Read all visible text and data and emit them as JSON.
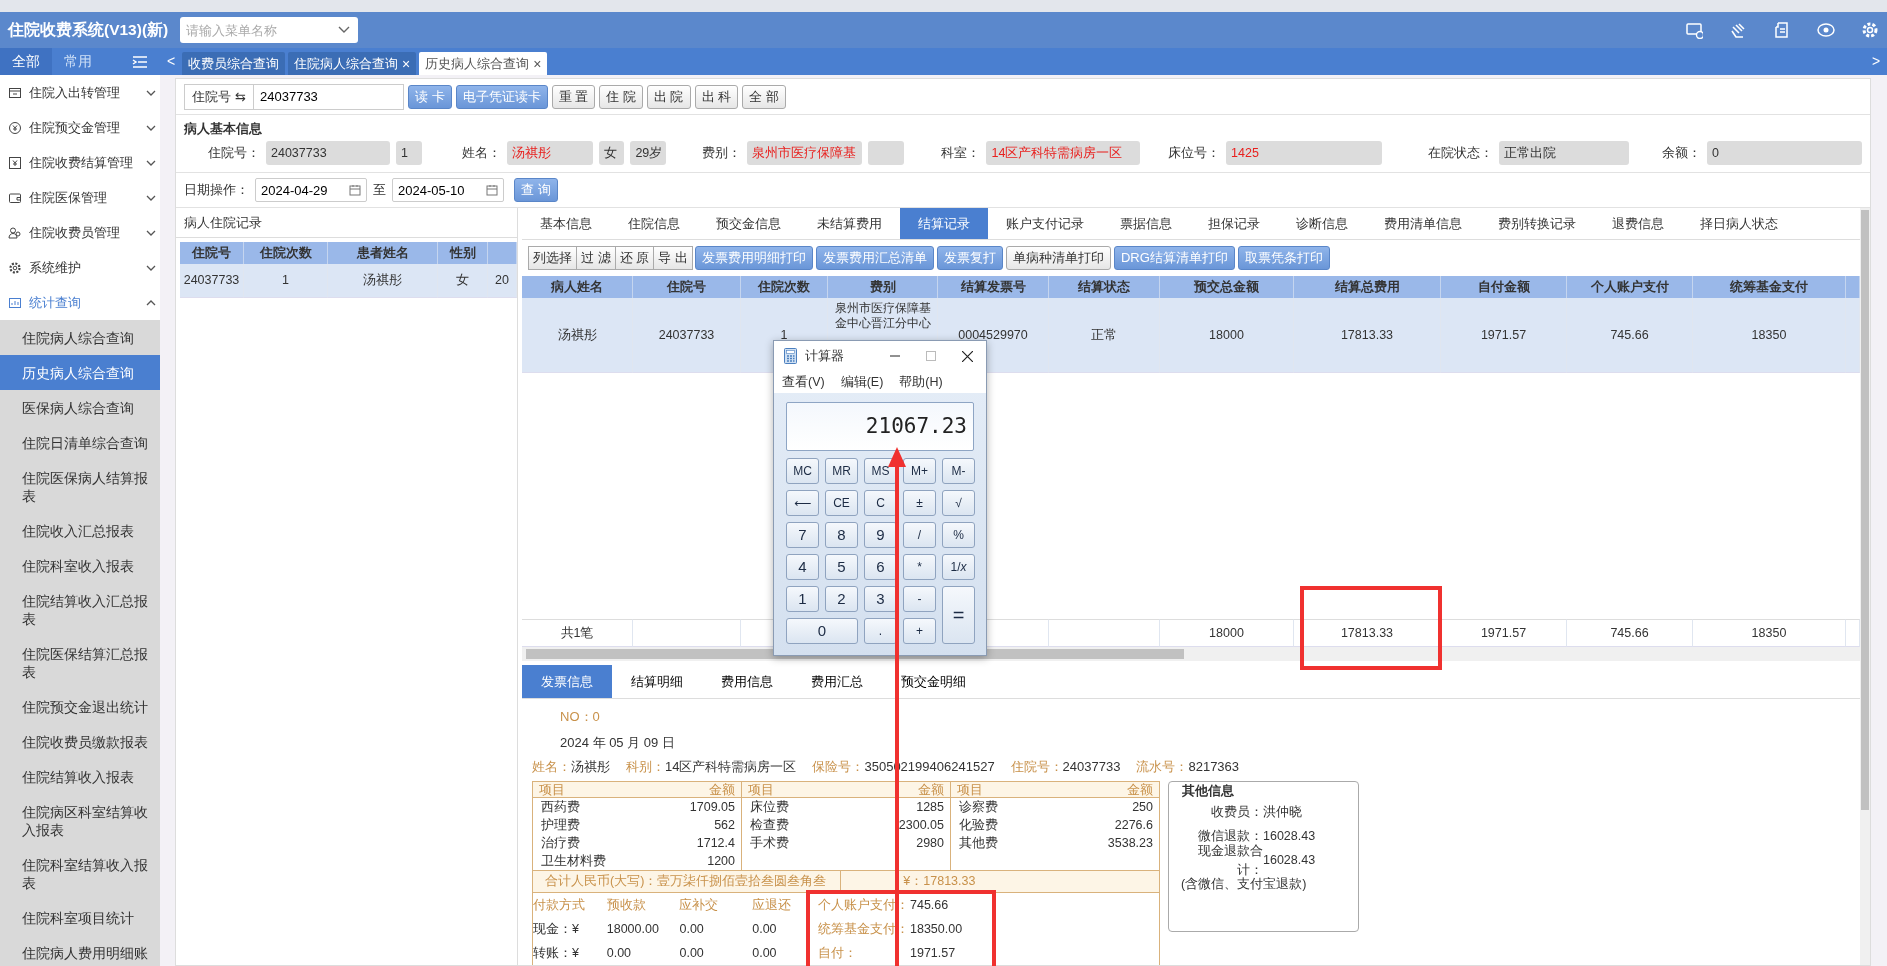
{
  "header": {
    "title": "住院收费系统(V13)(新)",
    "menu_search": {
      "placeholder": "请输入菜单名称"
    }
  },
  "sidebar": {
    "tabs": [
      {
        "label": "全部",
        "selected": true
      },
      {
        "label": "常用",
        "selected": false
      }
    ],
    "groups": [
      {
        "label": "住院入出转管理",
        "expanded": false
      },
      {
        "label": "住院预交金管理",
        "expanded": false
      },
      {
        "label": "住院收费结算管理",
        "expanded": false
      },
      {
        "label": "住院医保管理",
        "expanded": false
      },
      {
        "label": "住院收费员管理",
        "expanded": false
      },
      {
        "label": "系统维护",
        "expanded": false
      },
      {
        "label": "统计查询",
        "expanded": true,
        "children": [
          {
            "label": "住院病人综合查询",
            "selected": false
          },
          {
            "label": "历史病人综合查询",
            "selected": true
          },
          {
            "label": "医保病人综合查询",
            "selected": false
          },
          {
            "label": "住院日清单综合查询",
            "selected": false
          },
          {
            "label": "住院医保病人结算报表",
            "selected": false
          },
          {
            "label": "住院收入汇总报表",
            "selected": false
          },
          {
            "label": "住院科室收入报表",
            "selected": false
          },
          {
            "label": "住院结算收入汇总报表",
            "selected": false
          },
          {
            "label": "住院医保结算汇总报表",
            "selected": false
          },
          {
            "label": "住院预交金退出统计",
            "selected": false
          },
          {
            "label": "住院收费员缴款报表",
            "selected": false
          },
          {
            "label": "住院结算收入报表",
            "selected": false
          },
          {
            "label": "住院病区科室结算收入报表",
            "selected": false
          },
          {
            "label": "住院科室结算收入报表",
            "selected": false
          },
          {
            "label": "住院科室项目统计",
            "selected": false
          },
          {
            "label": "住院病人费用明细账",
            "selected": false
          }
        ]
      }
    ]
  },
  "page_tabs": {
    "scroll_left": "<",
    "scroll_right": ">",
    "items": [
      {
        "label": "收费员综合查询",
        "selected": false
      },
      {
        "label": "住院病人综合查询",
        "selected": false,
        "close": "×"
      },
      {
        "label": "历史病人综合查询",
        "selected": true,
        "close": "×"
      }
    ]
  },
  "search_bar": {
    "key_label": "住院号",
    "swap_glyph": "⇆",
    "value": "24037733",
    "buttons": [
      {
        "label": "读 卡",
        "kind": "primary"
      },
      {
        "label": "电子凭证读卡",
        "kind": "primary"
      },
      {
        "label": "重 置",
        "kind": "default"
      },
      {
        "label": "住 院",
        "kind": "default"
      },
      {
        "label": "出 院",
        "kind": "default"
      },
      {
        "label": "出 科",
        "kind": "default"
      },
      {
        "label": "全 部",
        "kind": "default"
      }
    ]
  },
  "patient_info": {
    "title": "病人基本信息",
    "fields": [
      {
        "label": "住院号：",
        "values": [
          {
            "kind": "text",
            "text": "24037733",
            "highlighted": false
          },
          {
            "kind": "text",
            "text": "1",
            "highlighted": false
          }
        ]
      },
      {
        "label": "姓名：",
        "values": [
          {
            "kind": "text",
            "text": "汤祺彤",
            "highlighted": true
          },
          {
            "kind": "text",
            "text": "女",
            "highlighted": false
          },
          {
            "kind": "text",
            "text": "29岁",
            "highlighted": false
          }
        ]
      },
      {
        "label": "费别：",
        "values": [
          {
            "kind": "text",
            "text": "泉州市医疗保障基",
            "highlighted": true
          },
          {
            "kind": "blank"
          }
        ]
      },
      {
        "label": "科室：",
        "values": [
          {
            "kind": "text",
            "text": "14区产科特需病房一区",
            "highlighted": true
          }
        ]
      },
      {
        "label": "床位号：",
        "values": [
          {
            "kind": "text",
            "text": "1425",
            "highlighted": true
          }
        ]
      },
      {
        "label": "在院状态：",
        "values": [
          {
            "kind": "text",
            "text": "正常出院",
            "highlighted": false
          }
        ]
      },
      {
        "label": "余额：",
        "values": [
          {
            "kind": "text",
            "text": "0",
            "highlighted": false
          }
        ]
      }
    ]
  },
  "date_filter": {
    "label": "日期操作：",
    "from": "2024-04-29",
    "to_label": "至",
    "to": "2024-05-10",
    "button": "查 询"
  },
  "records_panel": {
    "title": "病人住院记录",
    "columns": [
      "住院号",
      "住院次数",
      "患者姓名",
      "性别"
    ],
    "rows": [
      {
        "selected": true,
        "cells": [
          "24037733",
          "1",
          "汤祺彤",
          "女",
          "20"
        ]
      }
    ]
  },
  "detail_tabs": [
    {
      "label": "基本信息",
      "selected": false
    },
    {
      "label": "住院信息",
      "selected": false
    },
    {
      "label": "预交金信息",
      "selected": false
    },
    {
      "label": "未结算费用",
      "selected": false
    },
    {
      "label": "结算记录",
      "selected": true
    },
    {
      "label": "账户支付记录",
      "selected": false
    },
    {
      "label": "票据信息",
      "selected": false
    },
    {
      "label": "担保记录",
      "selected": false
    },
    {
      "label": "诊断信息",
      "selected": false
    },
    {
      "label": "费用清单信息",
      "selected": false
    },
    {
      "label": "费别转换记录",
      "selected": false
    },
    {
      "label": "退费信息",
      "selected": false
    },
    {
      "label": "择日病人状态",
      "selected": false
    }
  ],
  "table_toolbar": [
    {
      "label": "列选择",
      "kind": "plain"
    },
    {
      "label": "过 滤",
      "kind": "plain"
    },
    {
      "label": "还 原",
      "kind": "plain"
    },
    {
      "label": "导 出",
      "kind": "plain"
    },
    {
      "label": "发票费用明细打印",
      "kind": "primary"
    },
    {
      "label": "发票费用汇总清单",
      "kind": "primary"
    },
    {
      "label": "发票复打",
      "kind": "primary"
    },
    {
      "label": "单病种清单打印",
      "kind": "default"
    },
    {
      "label": "DRG结算清单打印",
      "kind": "primary"
    },
    {
      "label": "取票凭条打印",
      "kind": "primary"
    }
  ],
  "settlement_table": {
    "columns": [
      "病人姓名",
      "住院号",
      "住院次数",
      "费别",
      "结算发票号",
      "结算状态",
      "预交总金额",
      "结算总费用",
      "自付金额",
      "个人账户支付",
      "统筹基金支付"
    ],
    "rows": [
      {
        "selected": true,
        "cells": [
          "汤祺彤",
          "24037733",
          "1",
          "泉州市医疗保障基金中心晋江分中心",
          "0004529970",
          "正常",
          "18000",
          "17813.33",
          "1971.57",
          "745.66",
          "18350"
        ]
      }
    ],
    "footer": {
      "label": "共1笔",
      "totals": [
        "18000",
        "17813.33",
        "1971.57",
        "745.66",
        "18350"
      ]
    }
  },
  "invoice_tabs": [
    {
      "label": "发票信息",
      "selected": true
    },
    {
      "label": "结算明细",
      "selected": false
    },
    {
      "label": "费用信息",
      "selected": false
    },
    {
      "label": "费用汇总",
      "selected": false
    },
    {
      "label": "预交金明细",
      "selected": false
    }
  ],
  "invoice": {
    "number": "NO：0",
    "date": "2024 年 05 月 09 日",
    "info": [
      {
        "label": "姓名：",
        "value": "汤祺彤"
      },
      {
        "label": "科别：",
        "value": "14区产科特需病房一区"
      },
      {
        "label": "保险号：",
        "value": "350502199406241527"
      },
      {
        "label": "住院号：",
        "value": "24037733"
      },
      {
        "label": "流水号：",
        "value": "8217363"
      }
    ],
    "fee_groups": [
      {
        "item_header": "项目",
        "amount_header": "金额",
        "items": [
          {
            "name": "西药费",
            "amount": "1709.05"
          },
          {
            "name": "护理费",
            "amount": "562"
          },
          {
            "name": "治疗费",
            "amount": "1712.4"
          },
          {
            "name": "卫生材料费",
            "amount": "1200"
          }
        ]
      },
      {
        "item_header": "项目",
        "amount_header": "金额",
        "items": [
          {
            "name": "床位费",
            "amount": "1285"
          },
          {
            "name": "检查费",
            "amount": "2300.05"
          },
          {
            "name": "手术费",
            "amount": "2980"
          }
        ]
      },
      {
        "item_header": "项目",
        "amount_header": "金额",
        "items": [
          {
            "name": "诊察费",
            "amount": "250"
          },
          {
            "name": "化验费",
            "amount": "2276.6"
          },
          {
            "name": "其他费",
            "amount": "3538.23"
          }
        ]
      }
    ],
    "total": {
      "label": "合计人民币(大写)：",
      "value": "壹万柒仟捌佰壹拾叁圆叁角叁",
      "amount": "¥：17813.33"
    },
    "payment": {
      "columns": [
        "付款方式",
        "预收款",
        "应补交",
        "应退还"
      ],
      "rows": [
        [
          "现金：¥",
          "18000.00",
          "0.00",
          "0.00"
        ],
        [
          "转账：¥",
          "0.00",
          "0.00",
          "0.00"
        ]
      ]
    },
    "funds": [
      {
        "label": "个人账户支付：",
        "value": "745.66"
      },
      {
        "label": "统筹基金支付：",
        "value": "18350.00"
      },
      {
        "label": "自付：",
        "value": "1971.57"
      }
    ],
    "other_info": {
      "title": "其他信息",
      "lines": [
        {
          "label": "收费员：",
          "value": "洪仲晓"
        },
        {
          "label": "微信退款：",
          "value": "16028.43"
        },
        {
          "label": "现金退款合计：",
          "value": "16028.43"
        }
      ],
      "note": "(含微信、支付宝退款)"
    }
  },
  "calculator": {
    "title": "计算器",
    "menu": [
      "查看(V)",
      "编辑(E)",
      "帮助(H)"
    ],
    "display": "21067.23",
    "keys": [
      {
        "label": "MC",
        "kind": "normal"
      },
      {
        "label": "MR",
        "kind": "normal"
      },
      {
        "label": "MS",
        "kind": "normal"
      },
      {
        "label": "M+",
        "kind": "normal"
      },
      {
        "label": "M-",
        "kind": "normal"
      },
      {
        "label": "⟵",
        "kind": "normal"
      },
      {
        "label": "CE",
        "kind": "normal"
      },
      {
        "label": "C",
        "kind": "normal"
      },
      {
        "label": "±",
        "kind": "normal"
      },
      {
        "label": "√",
        "kind": "normal"
      },
      {
        "label": "7",
        "kind": "normal"
      },
      {
        "label": "8",
        "kind": "normal"
      },
      {
        "label": "9",
        "kind": "normal"
      },
      {
        "label": "/",
        "kind": "normal"
      },
      {
        "label": "%",
        "kind": "normal"
      },
      {
        "label": "4",
        "kind": "normal"
      },
      {
        "label": "5",
        "kind": "normal"
      },
      {
        "label": "6",
        "kind": "normal"
      },
      {
        "label": "*",
        "kind": "normal"
      },
      {
        "label": "1/*x*",
        "kind": "normal"
      },
      {
        "label": "1",
        "kind": "normal"
      },
      {
        "label": "2",
        "kind": "normal"
      },
      {
        "label": "3",
        "kind": "normal"
      },
      {
        "label": "-",
        "kind": "normal"
      },
      {
        "label": "=",
        "kind": "tall"
      },
      {
        "label": "0",
        "kind": "wide"
      },
      {
        "label": ".",
        "kind": "normal"
      },
      {
        "label": "+",
        "kind": "normal"
      }
    ]
  }
}
